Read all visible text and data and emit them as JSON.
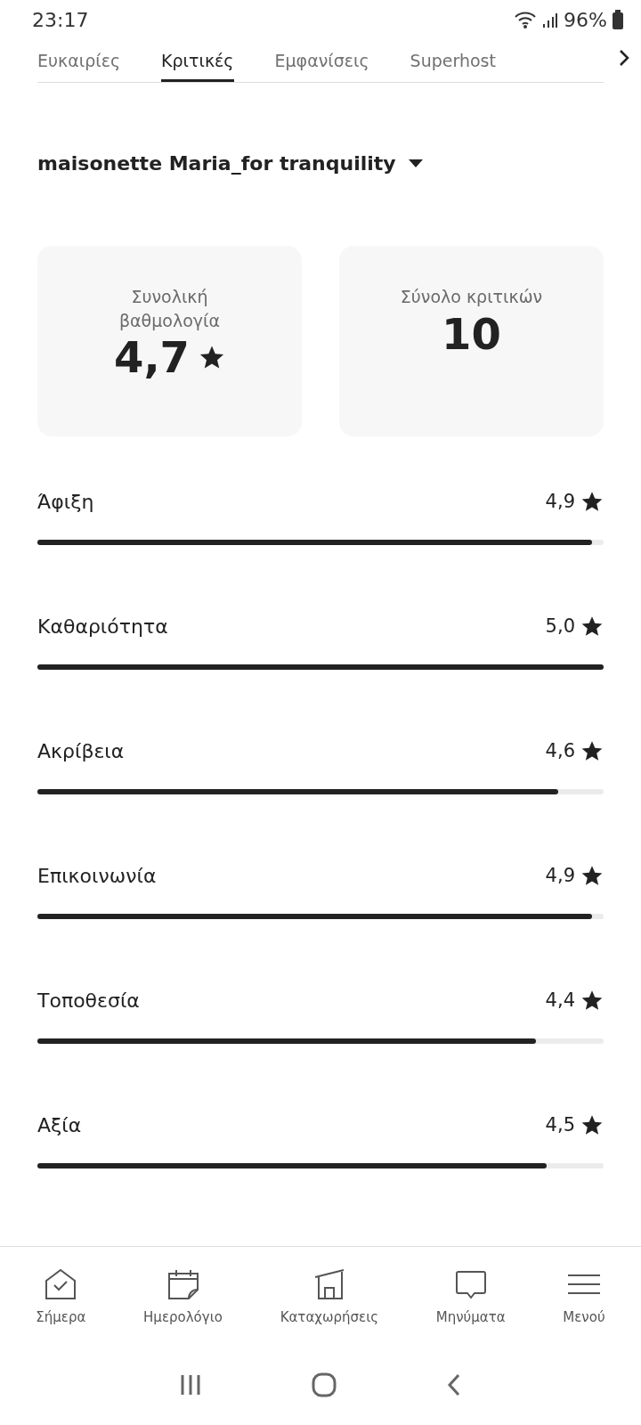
{
  "status_bar": {
    "time": "23:17",
    "battery": "96%"
  },
  "tabs": [
    {
      "label": "Ευκαιρίες",
      "selected": false
    },
    {
      "label": "Κριτικές",
      "selected": true
    },
    {
      "label": "Εμφανίσεις",
      "selected": false
    },
    {
      "label": "Superhost",
      "selected": false
    }
  ],
  "listing_selector": {
    "label": "maisonette Maria_for tranquility"
  },
  "summary_cards": [
    {
      "label": "Συνολική βαθμολογία",
      "value": "4,7",
      "star": true
    },
    {
      "label": "Σύνολο κριτικών",
      "value": "10",
      "star": false
    }
  ],
  "categories": [
    {
      "name": "Άφιξη",
      "score": "4,9",
      "level": 0.98
    },
    {
      "name": "Καθαριότητα",
      "score": "5,0",
      "level": 1
    },
    {
      "name": "Ακρίβεια",
      "score": "4,6",
      "level": 0.92
    },
    {
      "name": "Επικοινωνία",
      "score": "4,9",
      "level": 0.98
    },
    {
      "name": "Τοποθεσία",
      "score": "4,4",
      "level": 0.88
    },
    {
      "name": "Αξία",
      "score": "4,5",
      "level": 0.9
    }
  ],
  "bottom_nav": [
    {
      "label": "Σήμερα",
      "kind": "today"
    },
    {
      "label": "Ημερολόγιο",
      "kind": "calendar"
    },
    {
      "label": "Καταχωρήσεις",
      "kind": "listings"
    },
    {
      "label": "Μηνύματα",
      "kind": "messages"
    },
    {
      "label": "Μενού",
      "kind": "menu"
    }
  ]
}
